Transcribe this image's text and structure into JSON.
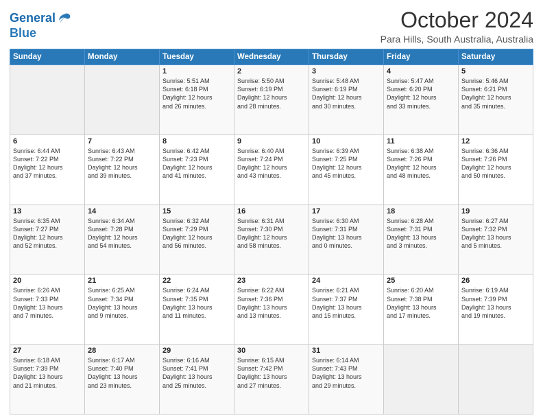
{
  "header": {
    "logo_line1": "General",
    "logo_line2": "Blue",
    "month": "October 2024",
    "location": "Para Hills, South Australia, Australia"
  },
  "days_of_week": [
    "Sunday",
    "Monday",
    "Tuesday",
    "Wednesday",
    "Thursday",
    "Friday",
    "Saturday"
  ],
  "weeks": [
    [
      {
        "day": "",
        "info": ""
      },
      {
        "day": "",
        "info": ""
      },
      {
        "day": "1",
        "info": "Sunrise: 5:51 AM\nSunset: 6:18 PM\nDaylight: 12 hours\nand 26 minutes."
      },
      {
        "day": "2",
        "info": "Sunrise: 5:50 AM\nSunset: 6:19 PM\nDaylight: 12 hours\nand 28 minutes."
      },
      {
        "day": "3",
        "info": "Sunrise: 5:48 AM\nSunset: 6:19 PM\nDaylight: 12 hours\nand 30 minutes."
      },
      {
        "day": "4",
        "info": "Sunrise: 5:47 AM\nSunset: 6:20 PM\nDaylight: 12 hours\nand 33 minutes."
      },
      {
        "day": "5",
        "info": "Sunrise: 5:46 AM\nSunset: 6:21 PM\nDaylight: 12 hours\nand 35 minutes."
      }
    ],
    [
      {
        "day": "6",
        "info": "Sunrise: 6:44 AM\nSunset: 7:22 PM\nDaylight: 12 hours\nand 37 minutes."
      },
      {
        "day": "7",
        "info": "Sunrise: 6:43 AM\nSunset: 7:22 PM\nDaylight: 12 hours\nand 39 minutes."
      },
      {
        "day": "8",
        "info": "Sunrise: 6:42 AM\nSunset: 7:23 PM\nDaylight: 12 hours\nand 41 minutes."
      },
      {
        "day": "9",
        "info": "Sunrise: 6:40 AM\nSunset: 7:24 PM\nDaylight: 12 hours\nand 43 minutes."
      },
      {
        "day": "10",
        "info": "Sunrise: 6:39 AM\nSunset: 7:25 PM\nDaylight: 12 hours\nand 45 minutes."
      },
      {
        "day": "11",
        "info": "Sunrise: 6:38 AM\nSunset: 7:26 PM\nDaylight: 12 hours\nand 48 minutes."
      },
      {
        "day": "12",
        "info": "Sunrise: 6:36 AM\nSunset: 7:26 PM\nDaylight: 12 hours\nand 50 minutes."
      }
    ],
    [
      {
        "day": "13",
        "info": "Sunrise: 6:35 AM\nSunset: 7:27 PM\nDaylight: 12 hours\nand 52 minutes."
      },
      {
        "day": "14",
        "info": "Sunrise: 6:34 AM\nSunset: 7:28 PM\nDaylight: 12 hours\nand 54 minutes."
      },
      {
        "day": "15",
        "info": "Sunrise: 6:32 AM\nSunset: 7:29 PM\nDaylight: 12 hours\nand 56 minutes."
      },
      {
        "day": "16",
        "info": "Sunrise: 6:31 AM\nSunset: 7:30 PM\nDaylight: 12 hours\nand 58 minutes."
      },
      {
        "day": "17",
        "info": "Sunrise: 6:30 AM\nSunset: 7:31 PM\nDaylight: 13 hours\nand 0 minutes."
      },
      {
        "day": "18",
        "info": "Sunrise: 6:28 AM\nSunset: 7:31 PM\nDaylight: 13 hours\nand 3 minutes."
      },
      {
        "day": "19",
        "info": "Sunrise: 6:27 AM\nSunset: 7:32 PM\nDaylight: 13 hours\nand 5 minutes."
      }
    ],
    [
      {
        "day": "20",
        "info": "Sunrise: 6:26 AM\nSunset: 7:33 PM\nDaylight: 13 hours\nand 7 minutes."
      },
      {
        "day": "21",
        "info": "Sunrise: 6:25 AM\nSunset: 7:34 PM\nDaylight: 13 hours\nand 9 minutes."
      },
      {
        "day": "22",
        "info": "Sunrise: 6:24 AM\nSunset: 7:35 PM\nDaylight: 13 hours\nand 11 minutes."
      },
      {
        "day": "23",
        "info": "Sunrise: 6:22 AM\nSunset: 7:36 PM\nDaylight: 13 hours\nand 13 minutes."
      },
      {
        "day": "24",
        "info": "Sunrise: 6:21 AM\nSunset: 7:37 PM\nDaylight: 13 hours\nand 15 minutes."
      },
      {
        "day": "25",
        "info": "Sunrise: 6:20 AM\nSunset: 7:38 PM\nDaylight: 13 hours\nand 17 minutes."
      },
      {
        "day": "26",
        "info": "Sunrise: 6:19 AM\nSunset: 7:39 PM\nDaylight: 13 hours\nand 19 minutes."
      }
    ],
    [
      {
        "day": "27",
        "info": "Sunrise: 6:18 AM\nSunset: 7:39 PM\nDaylight: 13 hours\nand 21 minutes."
      },
      {
        "day": "28",
        "info": "Sunrise: 6:17 AM\nSunset: 7:40 PM\nDaylight: 13 hours\nand 23 minutes."
      },
      {
        "day": "29",
        "info": "Sunrise: 6:16 AM\nSunset: 7:41 PM\nDaylight: 13 hours\nand 25 minutes."
      },
      {
        "day": "30",
        "info": "Sunrise: 6:15 AM\nSunset: 7:42 PM\nDaylight: 13 hours\nand 27 minutes."
      },
      {
        "day": "31",
        "info": "Sunrise: 6:14 AM\nSunset: 7:43 PM\nDaylight: 13 hours\nand 29 minutes."
      },
      {
        "day": "",
        "info": ""
      },
      {
        "day": "",
        "info": ""
      }
    ]
  ]
}
